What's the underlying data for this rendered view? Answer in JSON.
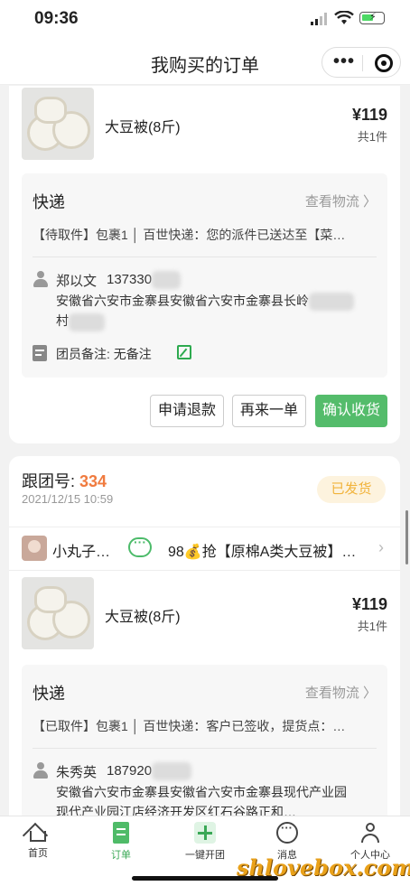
{
  "status_bar": {
    "time": "09:36"
  },
  "navbar": {
    "title": "我购买的订单"
  },
  "orders": [
    {
      "product": {
        "name": "大豆被(8斤)",
        "price": "¥119",
        "qty": "共1件"
      },
      "logistics": {
        "title": "快递",
        "track_label": "查看物流 〉",
        "status": "【待取件】包裹1 │ 百世快递：您的派件已送达至【菜…",
        "name": "郑以文",
        "phone": "137330",
        "address": "安徽省六安市金寨县安徽省六安市金寨县长岭",
        "address2": "村",
        "note": "团员备注: 无备注"
      },
      "buttons": {
        "refund": "申请退款",
        "again": "再来一单",
        "confirm": "确认收货"
      }
    },
    {
      "group_label": "跟团号: ",
      "group_no": "334",
      "date": "2021/12/15 10:59",
      "badge": "已发货",
      "leader": "小丸子…",
      "group_text": "98💰抢【原棉A类大豆被】…",
      "product": {
        "name": "大豆被(8斤)",
        "price": "¥119",
        "qty": "共1件"
      },
      "logistics": {
        "title": "快递",
        "track_label": "查看物流 〉",
        "status": "【已取件】包裹1 │ 百世快递：客户已签收，提货点：…",
        "name": "朱秀英",
        "phone": "187920",
        "address": "安徽省六安市金寨县安徽省六安市金寨县现代产业园",
        "address2": "现代产业园江店经济开发区红石谷路正和…"
      }
    }
  ],
  "tabbar": {
    "home": "首页",
    "orders": "订单",
    "start_group": "一键开团",
    "messages": "消息",
    "profile": "个人中心"
  },
  "watermark": "shlovebox.com",
  "colors": {
    "accent": "#54bc6b",
    "group_number": "#f07b3f",
    "badge_text": "#f1b33b"
  }
}
